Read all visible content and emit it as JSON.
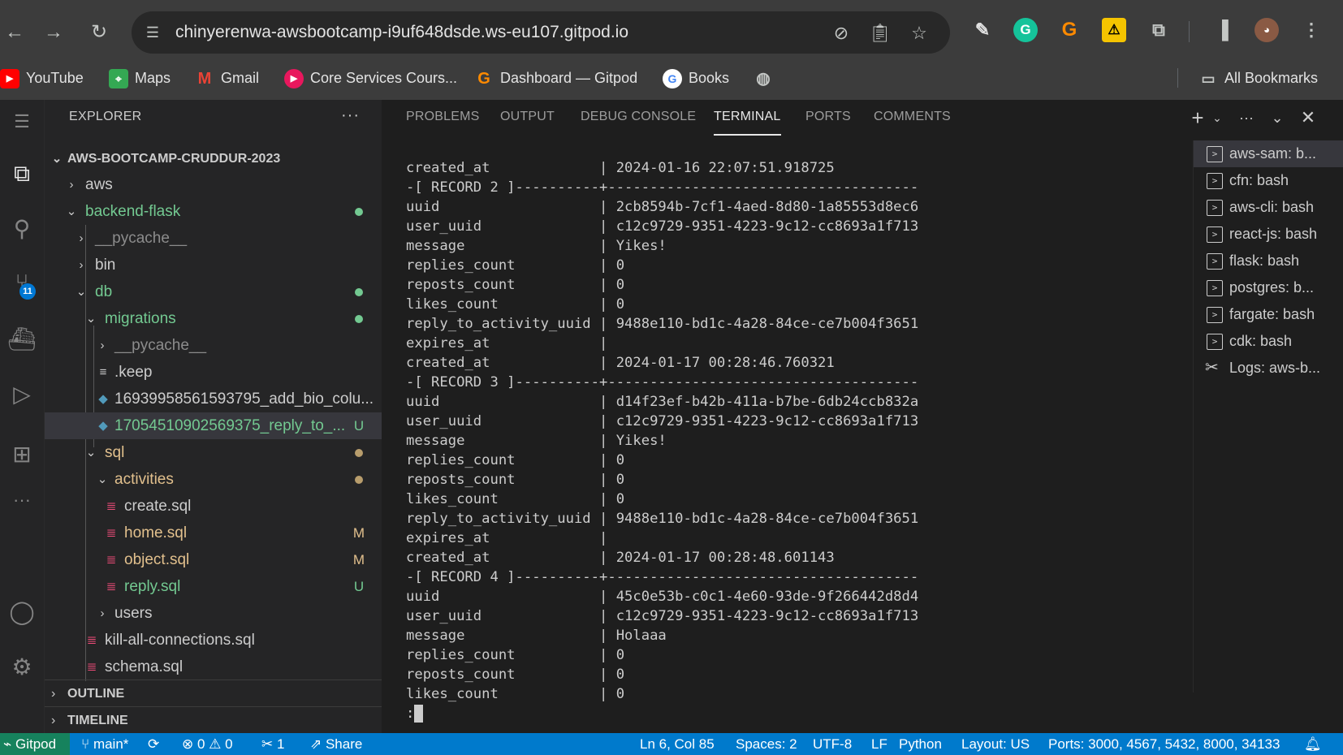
{
  "browser": {
    "url": "chinyerenwa-awsbootcamp-i9uf648dsde.ws-eu107.gitpod.io",
    "bookmarks": [
      {
        "label": "YouTube"
      },
      {
        "label": "Maps"
      },
      {
        "label": "Gmail"
      },
      {
        "label": "Core Services Cours..."
      },
      {
        "label": "Dashboard — Gitpod"
      },
      {
        "label": "Books"
      }
    ],
    "all_bookmarks": "All Bookmarks"
  },
  "explorer": {
    "title": "EXPLORER",
    "more": "···",
    "root": "AWS-BOOTCAMP-CRUDDUR-2023",
    "items": [
      {
        "label": "aws"
      },
      {
        "label": "backend-flask"
      },
      {
        "label": "__pycache__"
      },
      {
        "label": "bin"
      },
      {
        "label": "db"
      },
      {
        "label": "migrations"
      },
      {
        "label": "__pycache__"
      },
      {
        "label": ".keep"
      },
      {
        "label": "16939958561593795_add_bio_colu..."
      },
      {
        "label": "17054510902569375_reply_to_...",
        "status": "U"
      },
      {
        "label": "sql"
      },
      {
        "label": "activities"
      },
      {
        "label": "create.sql"
      },
      {
        "label": "home.sql",
        "status": "M"
      },
      {
        "label": "object.sql",
        "status": "M"
      },
      {
        "label": "reply.sql",
        "status": "U"
      },
      {
        "label": "users"
      },
      {
        "label": "kill-all-connections.sql"
      },
      {
        "label": "schema.sql"
      }
    ],
    "outline": "OUTLINE",
    "timeline": "TIMELINE"
  },
  "activity_bar": {
    "scm_badge": "11"
  },
  "panel": {
    "tabs": [
      "PROBLEMS",
      "OUTPUT",
      "DEBUG CONSOLE",
      "TERMINAL",
      "PORTS",
      "COMMENTS"
    ],
    "active_tab": "TERMINAL"
  },
  "terminal": {
    "lines": [
      "created_at             | 2024-01-16 22:07:51.918725",
      "-[ RECORD 2 ]----------+-------------------------------------",
      "uuid                   | 2cb8594b-7cf1-4aed-8d80-1a85553d8ec6",
      "user_uuid              | c12c9729-9351-4223-9c12-cc8693a1f713",
      "message                | Yikes!",
      "replies_count          | 0",
      "reposts_count          | 0",
      "likes_count            | 0",
      "reply_to_activity_uuid | 9488e110-bd1c-4a28-84ce-ce7b004f3651",
      "expires_at             |",
      "created_at             | 2024-01-17 00:28:46.760321",
      "-[ RECORD 3 ]----------+-------------------------------------",
      "uuid                   | d14f23ef-b42b-411a-b7be-6db24ccb832a",
      "user_uuid              | c12c9729-9351-4223-9c12-cc8693a1f713",
      "message                | Yikes!",
      "replies_count          | 0",
      "reposts_count          | 0",
      "likes_count            | 0",
      "reply_to_activity_uuid | 9488e110-bd1c-4a28-84ce-ce7b004f3651",
      "expires_at             |",
      "created_at             | 2024-01-17 00:28:48.601143",
      "-[ RECORD 4 ]----------+-------------------------------------",
      "uuid                   | 45c0e53b-c0c1-4e60-93de-9f266442d8d4",
      "user_uuid              | c12c9729-9351-4223-9c12-cc8693a1f713",
      "message                | Holaaa",
      "replies_count          | 0",
      "reposts_count          | 0",
      "likes_count            | 0"
    ],
    "prompt": ":"
  },
  "terminal_list": [
    "aws-sam: b...",
    "cfn: bash",
    "aws-cli: bash",
    "react-js: bash",
    "flask: bash",
    "postgres: b...",
    "fargate: bash",
    "cdk: bash",
    "Logs: aws-b..."
  ],
  "statusbar": {
    "remote": "Gitpod",
    "branch": "main*",
    "errors": "0",
    "warnings": "0",
    "ports_count": "1",
    "share": "Share",
    "position": "Ln 6, Col 85",
    "spaces": "Spaces: 2",
    "encoding": "UTF-8",
    "eol": "LF",
    "language": "Python",
    "layout": "Layout: US",
    "ports": "Ports: 3000, 4567, 5432, 8000, 34133"
  },
  "colors": {
    "statusbar": "#007acc",
    "remote": "#16825d",
    "untracked": "#73c991",
    "modified": "#e2c08d",
    "sql_icon": "#f14c7a",
    "python_icon": "#519aba"
  }
}
